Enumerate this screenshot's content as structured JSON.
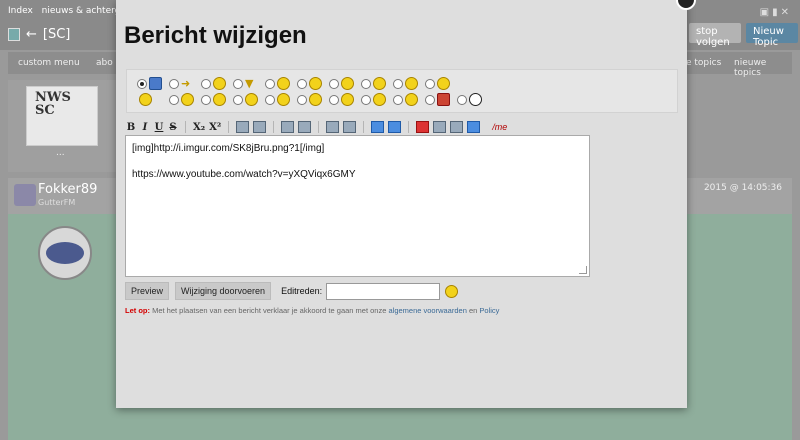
{
  "background": {
    "breadcrumb": [
      "Index",
      "nieuws & achtergrond"
    ],
    "topic_title": "[SC]",
    "follow_button": "stop volgen",
    "new_topic_button": "Nieuw Topic",
    "menu_items": [
      "custom menu",
      "abo",
      "e topics",
      "nieuwe topics"
    ],
    "logo_text": "NWS SC",
    "post_username": "Fokker89",
    "post_rank": "GutterFM",
    "post_date": "2015 @ 14:05:36",
    "more_dots": "..."
  },
  "modal": {
    "title": "Bericht wijzigen",
    "smileys_row1": [
      "default",
      "square-blue",
      "arrow",
      "lightbulb",
      "warning",
      "smile",
      "cool",
      "grin",
      "confused",
      "wink-tongue",
      "biggrin"
    ],
    "smileys_row2": [
      "laugh",
      "shock",
      "surprised",
      "thumbs",
      "hand",
      "happy",
      "kiss",
      "devil",
      "dizzy",
      "superman",
      "football"
    ],
    "toolbar": {
      "bold": "B",
      "italic": "I",
      "underline": "U",
      "strike": "S",
      "subscript": "X₂",
      "superscript": "X²",
      "me": "/me"
    },
    "editor_lines": [
      "[img]http://i.imgur.com/SK8jBru.png?1[/img]",
      "https://www.youtube.com/watch?v=yXQViqx6GMY"
    ],
    "preview_button": "Preview",
    "submit_button": "Wijziging doorvoeren",
    "edit_reason_label": "Editreden:",
    "edit_reason_value": "",
    "notice": {
      "warning": "Let op:",
      "text": " Met het plaatsen van een bericht verklaar je akkoord te gaan met onze ",
      "link1": "algemene voorwaarden",
      "and": " en ",
      "link2": "Policy"
    }
  }
}
